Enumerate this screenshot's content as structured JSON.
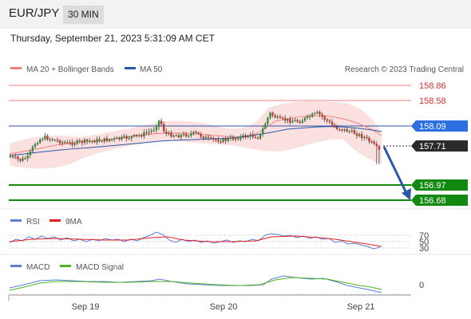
{
  "header": {
    "symbol": "EUR/JPY",
    "timeframe": "30 MIN"
  },
  "timestamp": "Thursday, September 21, 2023 5:31:09 AM CET",
  "legend": {
    "ma_bb": "MA 20 + Bollinger Bands",
    "ma50": "MA 50",
    "credit": "Research © 2023 Trading Central"
  },
  "colors": {
    "ma20": "#f08080",
    "ma50": "#2c56a8",
    "up": "#2f8f3a",
    "down": "#c0392b",
    "green_line": "#128a12",
    "rsi": "#5b7fd6",
    "rsi_ma": "#e02020",
    "macd": "#5b7fd6",
    "macd_signal": "#4db320"
  },
  "chart_data": [
    {
      "type": "candlestick",
      "title": "EUR/JPY",
      "xlabels": [
        "Sep 19",
        "Sep 20",
        "Sep 21"
      ],
      "ylim": [
        156.55,
        159.05
      ],
      "levels": [
        {
          "value": 158.86,
          "label": "158.86",
          "kind": "resistance"
        },
        {
          "value": 158.58,
          "label": "158.58",
          "kind": "resistance"
        },
        {
          "value": 158.09,
          "label": "158.09",
          "kind": "ma50"
        },
        {
          "value": 157.71,
          "label": "157.71",
          "kind": "last"
        },
        {
          "value": 156.97,
          "label": "156.97",
          "kind": "target"
        },
        {
          "value": 156.68,
          "label": "156.68",
          "kind": "target"
        }
      ],
      "forecast_arrow": {
        "from": 157.71,
        "to": 156.72
      }
    },
    {
      "type": "line",
      "name": "RSI",
      "series_names": [
        "RSI",
        "9MA"
      ],
      "levels": [
        "70",
        "50",
        "30"
      ]
    },
    {
      "type": "line",
      "name": "MACD",
      "series_names": [
        "MACD",
        "MACD Signal"
      ],
      "levels": [
        "0"
      ]
    }
  ]
}
